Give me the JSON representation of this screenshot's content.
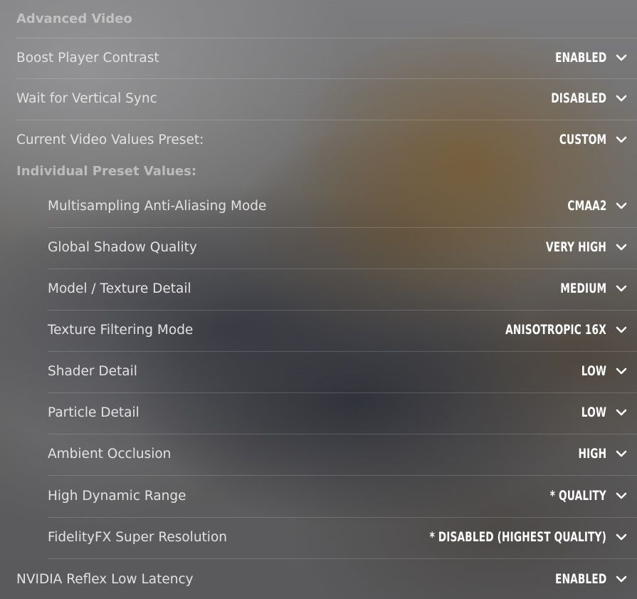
{
  "headers": {
    "advanced_video": "Advanced Video",
    "individual_preset_values": "Individual Preset Values:"
  },
  "settings": {
    "boost_player_contrast": {
      "label": "Boost Player Contrast",
      "value": "ENABLED"
    },
    "wait_for_vertical_sync": {
      "label": "Wait for Vertical Sync",
      "value": "DISABLED"
    },
    "current_video_values_preset": {
      "label": "Current Video Values Preset:",
      "value": "CUSTOM"
    },
    "multisampling_anti_aliasing_mode": {
      "label": "Multisampling Anti-Aliasing Mode",
      "value": "CMAA2"
    },
    "global_shadow_quality": {
      "label": "Global Shadow Quality",
      "value": "VERY HIGH"
    },
    "model_texture_detail": {
      "label": "Model / Texture Detail",
      "value": "MEDIUM"
    },
    "texture_filtering_mode": {
      "label": "Texture Filtering Mode",
      "value": "ANISOTROPIC 16X"
    },
    "shader_detail": {
      "label": "Shader Detail",
      "value": "LOW"
    },
    "particle_detail": {
      "label": "Particle Detail",
      "value": "LOW"
    },
    "ambient_occlusion": {
      "label": "Ambient Occlusion",
      "value": "HIGH"
    },
    "high_dynamic_range": {
      "label": "High Dynamic Range",
      "value": "* QUALITY"
    },
    "fidelityfx_super_resolution": {
      "label": "FidelityFX Super Resolution",
      "value": "* DISABLED (HIGHEST QUALITY)"
    },
    "nvidia_reflex_low_latency": {
      "label": "NVIDIA Reflex Low Latency",
      "value": "ENABLED"
    }
  },
  "icons": {
    "dropdown": "chevron-down-icon"
  },
  "colors": {
    "text": "#e2e2e2",
    "value": "#ffffff",
    "header": "#b4b4b4"
  }
}
